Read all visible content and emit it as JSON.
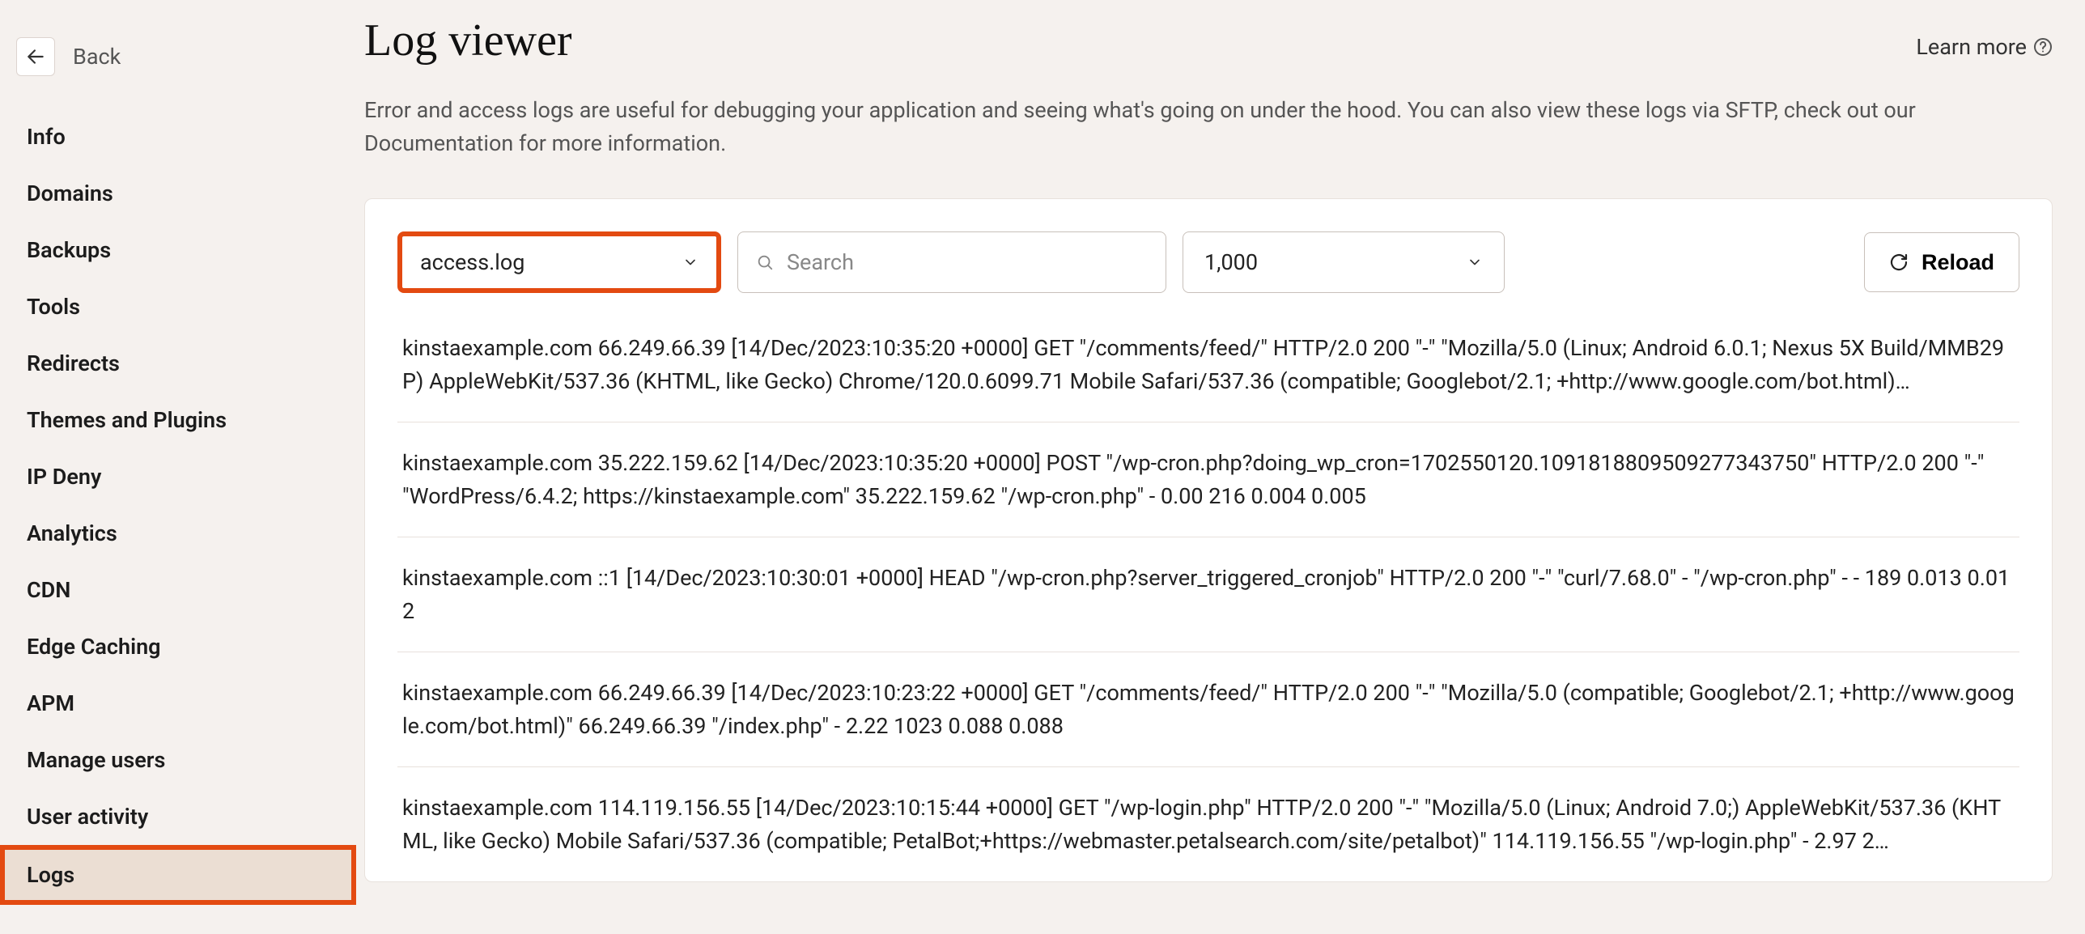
{
  "back_label": "Back",
  "sidebar": {
    "items": [
      {
        "label": "Info",
        "active": false
      },
      {
        "label": "Domains",
        "active": false
      },
      {
        "label": "Backups",
        "active": false
      },
      {
        "label": "Tools",
        "active": false
      },
      {
        "label": "Redirects",
        "active": false
      },
      {
        "label": "Themes and Plugins",
        "active": false
      },
      {
        "label": "IP Deny",
        "active": false
      },
      {
        "label": "Analytics",
        "active": false
      },
      {
        "label": "CDN",
        "active": false
      },
      {
        "label": "Edge Caching",
        "active": false
      },
      {
        "label": "APM",
        "active": false
      },
      {
        "label": "Manage users",
        "active": false
      },
      {
        "label": "User activity",
        "active": false
      },
      {
        "label": "Logs",
        "active": true
      }
    ]
  },
  "header": {
    "title": "Log viewer",
    "learn_more": "Learn more",
    "description": "Error and access logs are useful for debugging your application and seeing what's going on under the hood. You can also view these logs via SFTP, check out our Documentation for more information."
  },
  "controls": {
    "log_type": "access.log",
    "search_placeholder": "Search",
    "count": "1,000",
    "reload_label": "Reload"
  },
  "logs": [
    "kinstaexample.com 66.249.66.39 [14/Dec/2023:10:35:20 +0000] GET \"/comments/feed/\" HTTP/2.0 200 \"-\" \"Mozilla/5.0 (Linux; Android 6.0.1; Nexus 5X Build/MMB29P) AppleWebKit/537.36 (KHTML, like Gecko) Chrome/120.0.6099.71 Mobile Safari/537.36 (compatible; Googlebot/2.1; +http://www.google.com/bot.html)…",
    "kinstaexample.com 35.222.159.62 [14/Dec/2023:10:35:20 +0000] POST \"/wp-cron.php?doing_wp_cron=1702550120.1091818809509277343750\" HTTP/2.0 200 \"-\" \"WordPress/6.4.2; https://kinstaexample.com\" 35.222.159.62 \"/wp-cron.php\" - 0.00 216 0.004 0.005",
    "kinstaexample.com ::1 [14/Dec/2023:10:30:01 +0000] HEAD \"/wp-cron.php?server_triggered_cronjob\" HTTP/2.0 200 \"-\" \"curl/7.68.0\" - \"/wp-cron.php\" - - 189 0.013 0.012",
    "kinstaexample.com 66.249.66.39 [14/Dec/2023:10:23:22 +0000] GET \"/comments/feed/\" HTTP/2.0 200 \"-\" \"Mozilla/5.0 (compatible; Googlebot/2.1; +http://www.google.com/bot.html)\" 66.249.66.39 \"/index.php\" - 2.22 1023 0.088 0.088",
    "kinstaexample.com 114.119.156.55 [14/Dec/2023:10:15:44 +0000] GET \"/wp-login.php\" HTTP/2.0 200 \"-\" \"Mozilla/5.0 (Linux; Android 7.0;) AppleWebKit/537.36 (KHTML, like Gecko) Mobile Safari/537.36 (compatible; PetalBot;+https://webmaster.petalsearch.com/site/petalbot)\" 114.119.156.55 \"/wp-login.php\" - 2.97 2…"
  ]
}
